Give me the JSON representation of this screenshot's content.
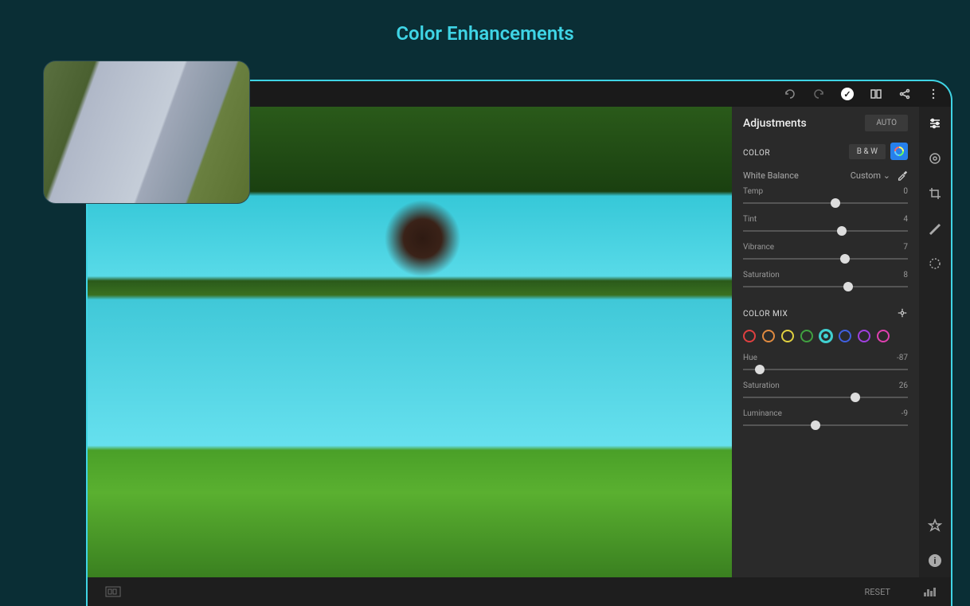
{
  "title": "Color Enhancements",
  "panel": {
    "heading": "Adjustments",
    "auto": "AUTO",
    "color_section": "COLOR",
    "bw_button": "B & W",
    "white_balance_label": "White Balance",
    "white_balance_value": "Custom",
    "sliders": {
      "temp": {
        "label": "Temp",
        "value": "0",
        "pos": 56
      },
      "tint": {
        "label": "Tint",
        "value": "4",
        "pos": 60
      },
      "vibrance": {
        "label": "Vibrance",
        "value": "7",
        "pos": 62
      },
      "saturation": {
        "label": "Saturation",
        "value": "8",
        "pos": 64
      }
    },
    "colormix_label": "COLOR MIX",
    "swatches": [
      "#e04040",
      "#e08a40",
      "#e0d040",
      "#40a040",
      "#40d0d0",
      "#4060e0",
      "#a040e0",
      "#e040b0"
    ],
    "selected_swatch": 4,
    "mix_sliders": {
      "hue": {
        "label": "Hue",
        "value": "-87",
        "pos": 10
      },
      "sat": {
        "label": "Saturation",
        "value": "26",
        "pos": 68
      },
      "lum": {
        "label": "Luminance",
        "value": "-9",
        "pos": 44
      }
    }
  },
  "bottom": {
    "reset": "RESET"
  }
}
